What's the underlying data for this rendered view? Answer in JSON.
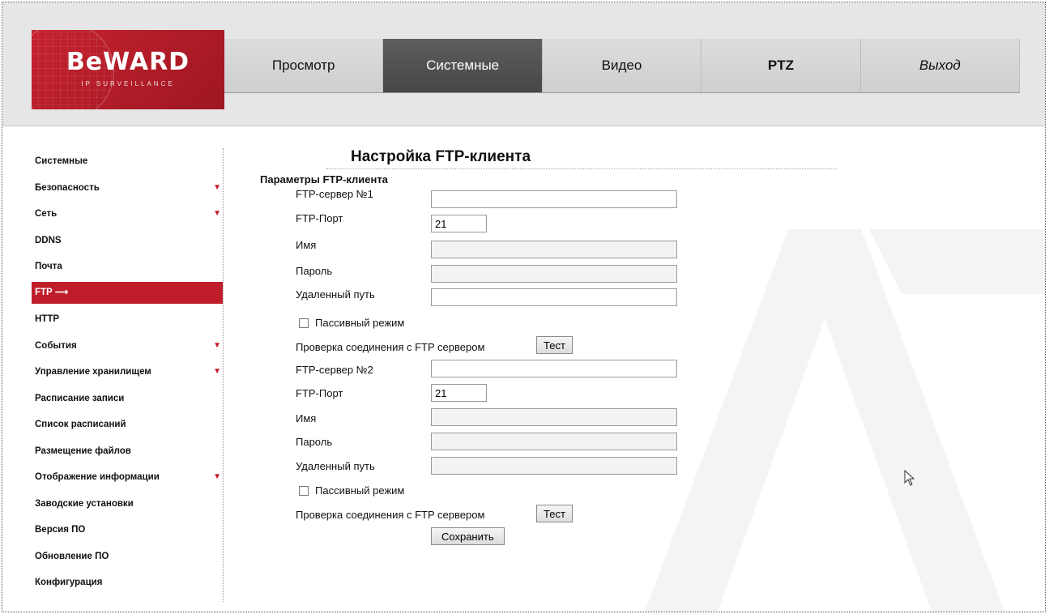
{
  "logo": {
    "brand": "BeWARD",
    "tagline": "IP SURVEILLANCE"
  },
  "nav": {
    "items": [
      {
        "label": "Просмотр"
      },
      {
        "label": "Системные"
      },
      {
        "label": "Видео"
      },
      {
        "label": "PTZ"
      },
      {
        "label": "Выход"
      }
    ]
  },
  "sidebar": {
    "items": [
      {
        "label": "Системные",
        "expandable": false
      },
      {
        "label": "Безопасность",
        "expandable": true
      },
      {
        "label": "Сеть",
        "expandable": true
      },
      {
        "label": "DDNS",
        "expandable": false
      },
      {
        "label": "Почта",
        "expandable": false
      },
      {
        "label": "FTP",
        "expandable": false,
        "active": true
      },
      {
        "label": "HTTP",
        "expandable": false
      },
      {
        "label": "События",
        "expandable": true
      },
      {
        "label": "Управление хранилищем",
        "expandable": true
      },
      {
        "label": "Расписание записи",
        "expandable": false
      },
      {
        "label": "Список расписаний",
        "expandable": false
      },
      {
        "label": "Размещение файлов",
        "expandable": false
      },
      {
        "label": "Отображение информации",
        "expandable": true
      },
      {
        "label": "Заводские установки",
        "expandable": false
      },
      {
        "label": "Версия ПО",
        "expandable": false
      },
      {
        "label": "Обновление ПО",
        "expandable": false
      },
      {
        "label": "Конфигурация",
        "expandable": false
      }
    ]
  },
  "main": {
    "title": "Настройка FTP-клиента",
    "section": "Параметры FTP-клиента",
    "server1": {
      "server_label": "FTP-сервер №1",
      "server_value": "",
      "port_label": "FTP-Порт",
      "port_value": "21",
      "name_label": "Имя",
      "name_value": "",
      "password_label": "Пароль",
      "password_value": "",
      "path_label": "Удаленный путь",
      "path_value": "",
      "passive_label": "Пассивный режим",
      "passive_checked": false,
      "test_label": "Проверка соединения с FTP сервером",
      "test_button": "Тест"
    },
    "server2": {
      "server_label": "FTP-сервер №2",
      "server_value": "",
      "port_label": "FTP-Порт",
      "port_value": "21",
      "name_label": "Имя",
      "name_value": "",
      "password_label": "Пароль",
      "password_value": "",
      "path_label": "Удаленный путь",
      "path_value": "",
      "passive_label": "Пассивный режим",
      "passive_checked": false,
      "test_label": "Проверка соединения с FTP сервером",
      "test_button": "Тест"
    },
    "save_button": "Сохранить"
  },
  "colors": {
    "brand_red": "#c01d2b",
    "nav_active": "#4f4f4f",
    "header_bg": "#e6e6e6"
  }
}
